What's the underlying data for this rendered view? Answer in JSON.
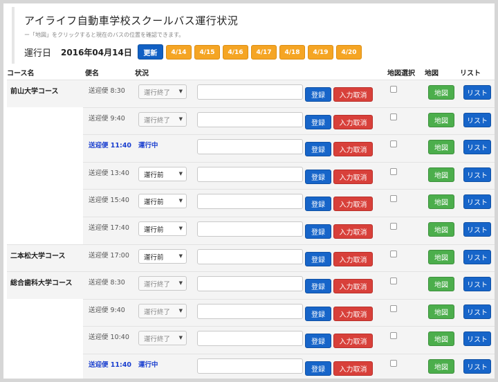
{
  "header": {
    "title": "アイライフ自動車学校スクールバス運行状況",
    "subtitle": "ー「地図」をクリックすると現在のバスの位置を確認できます。",
    "date_label": "運行日",
    "date_value": "2016年04月14日",
    "update_label": "更新",
    "date_tabs": [
      "4/14",
      "4/15",
      "4/16",
      "4/17",
      "4/18",
      "4/19",
      "4/20"
    ]
  },
  "columns": {
    "course": "コース名",
    "trip": "便名",
    "status": "状況",
    "map_select": "地図選択",
    "map": "地図",
    "list": "リスト"
  },
  "labels": {
    "register": "登録",
    "cancel": "入力取消",
    "map": "地図",
    "list": "リスト"
  },
  "rows": [
    {
      "course": "前山大学コース",
      "trip": "送迎便 8:30",
      "status": "運行終了",
      "mode": "select-disabled"
    },
    {
      "course": "",
      "trip": "送迎便 9:40",
      "status": "運行終了",
      "mode": "select-disabled"
    },
    {
      "course": "",
      "trip": "送迎便 11:40",
      "status": "運行中",
      "mode": "text"
    },
    {
      "course": "",
      "trip": "送迎便 13:40",
      "status": "運行前",
      "mode": "select"
    },
    {
      "course": "",
      "trip": "送迎便 15:40",
      "status": "運行前",
      "mode": "select"
    },
    {
      "course": "",
      "trip": "送迎便 17:40",
      "status": "運行前",
      "mode": "select"
    },
    {
      "course": "二本松大学コース",
      "trip": "送迎便 17:00",
      "status": "運行前",
      "mode": "select"
    },
    {
      "course": "総合歯科大学コース",
      "trip": "送迎便 8:30",
      "status": "運行終了",
      "mode": "select-disabled"
    },
    {
      "course": "",
      "trip": "送迎便 9:40",
      "status": "運行終了",
      "mode": "select-disabled"
    },
    {
      "course": "",
      "trip": "送迎便 10:40",
      "status": "運行終了",
      "mode": "select-disabled"
    },
    {
      "course": "",
      "trip": "送迎便 11:40",
      "status": "運行中",
      "mode": "text"
    }
  ]
}
